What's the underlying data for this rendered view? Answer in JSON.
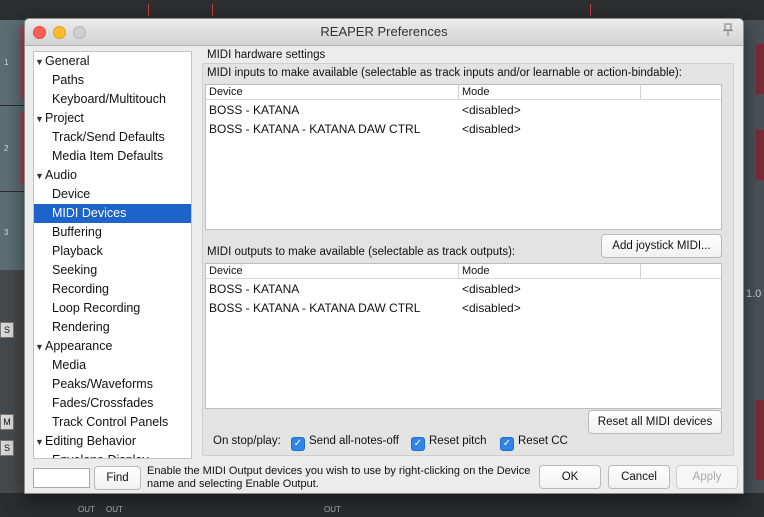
{
  "window": {
    "title": "REAPER Preferences"
  },
  "background": {
    "tracks": [
      "1",
      "2",
      "3"
    ],
    "right_label": "1.0",
    "side_buttons": [
      "S",
      "M",
      "S"
    ],
    "out_label": "OUT"
  },
  "nav": {
    "items": [
      {
        "label": "General",
        "type": "category"
      },
      {
        "label": "Paths",
        "type": "sub"
      },
      {
        "label": "Keyboard/Multitouch",
        "type": "sub"
      },
      {
        "label": "Project",
        "type": "category"
      },
      {
        "label": "Track/Send Defaults",
        "type": "sub"
      },
      {
        "label": "Media Item Defaults",
        "type": "sub"
      },
      {
        "label": "Audio",
        "type": "category"
      },
      {
        "label": "Device",
        "type": "sub"
      },
      {
        "label": "MIDI Devices",
        "type": "sub",
        "selected": true
      },
      {
        "label": "Buffering",
        "type": "sub"
      },
      {
        "label": "Playback",
        "type": "sub"
      },
      {
        "label": "Seeking",
        "type": "sub"
      },
      {
        "label": "Recording",
        "type": "sub"
      },
      {
        "label": "Loop Recording",
        "type": "sub"
      },
      {
        "label": "Rendering",
        "type": "sub"
      },
      {
        "label": "Appearance",
        "type": "category"
      },
      {
        "label": "Media",
        "type": "sub"
      },
      {
        "label": "Peaks/Waveforms",
        "type": "sub"
      },
      {
        "label": "Fades/Crossfades",
        "type": "sub"
      },
      {
        "label": "Track Control Panels",
        "type": "sub"
      },
      {
        "label": "Editing Behavior",
        "type": "category"
      },
      {
        "label": "Envelope Display",
        "type": "sub"
      }
    ]
  },
  "content": {
    "section_title": "MIDI hardware settings",
    "inputs": {
      "label": "MIDI inputs to make available (selectable as track inputs and/or learnable or action-bindable):",
      "columns": [
        "Device",
        "Mode"
      ],
      "rows": [
        {
          "device": "BOSS - KATANA",
          "mode": "<disabled>"
        },
        {
          "device": "BOSS - KATANA - KATANA DAW CTRL",
          "mode": "<disabled>"
        }
      ]
    },
    "add_joystick_label": "Add joystick MIDI...",
    "outputs": {
      "label": "MIDI outputs to make available (selectable as track outputs):",
      "columns": [
        "Device",
        "Mode"
      ],
      "rows": [
        {
          "device": "BOSS - KATANA",
          "mode": "<disabled>"
        },
        {
          "device": "BOSS - KATANA - KATANA DAW CTRL",
          "mode": "<disabled>"
        }
      ]
    },
    "reset_all_label": "Reset all MIDI devices",
    "on_stop_label": "On stop/play:",
    "checkboxes": [
      {
        "label": "Send all-notes-off",
        "checked": true
      },
      {
        "label": "Reset pitch",
        "checked": true
      },
      {
        "label": "Reset CC",
        "checked": true
      }
    ]
  },
  "footer": {
    "find_value": "",
    "find_label": "Find",
    "hint": "Enable the MIDI Output devices you wish to use by right-clicking on the Device name and selecting Enable Output.",
    "ok_label": "OK",
    "cancel_label": "Cancel",
    "apply_label": "Apply"
  },
  "colors": {
    "selection": "#1d63c9",
    "checkbox": "#2f86e6"
  }
}
